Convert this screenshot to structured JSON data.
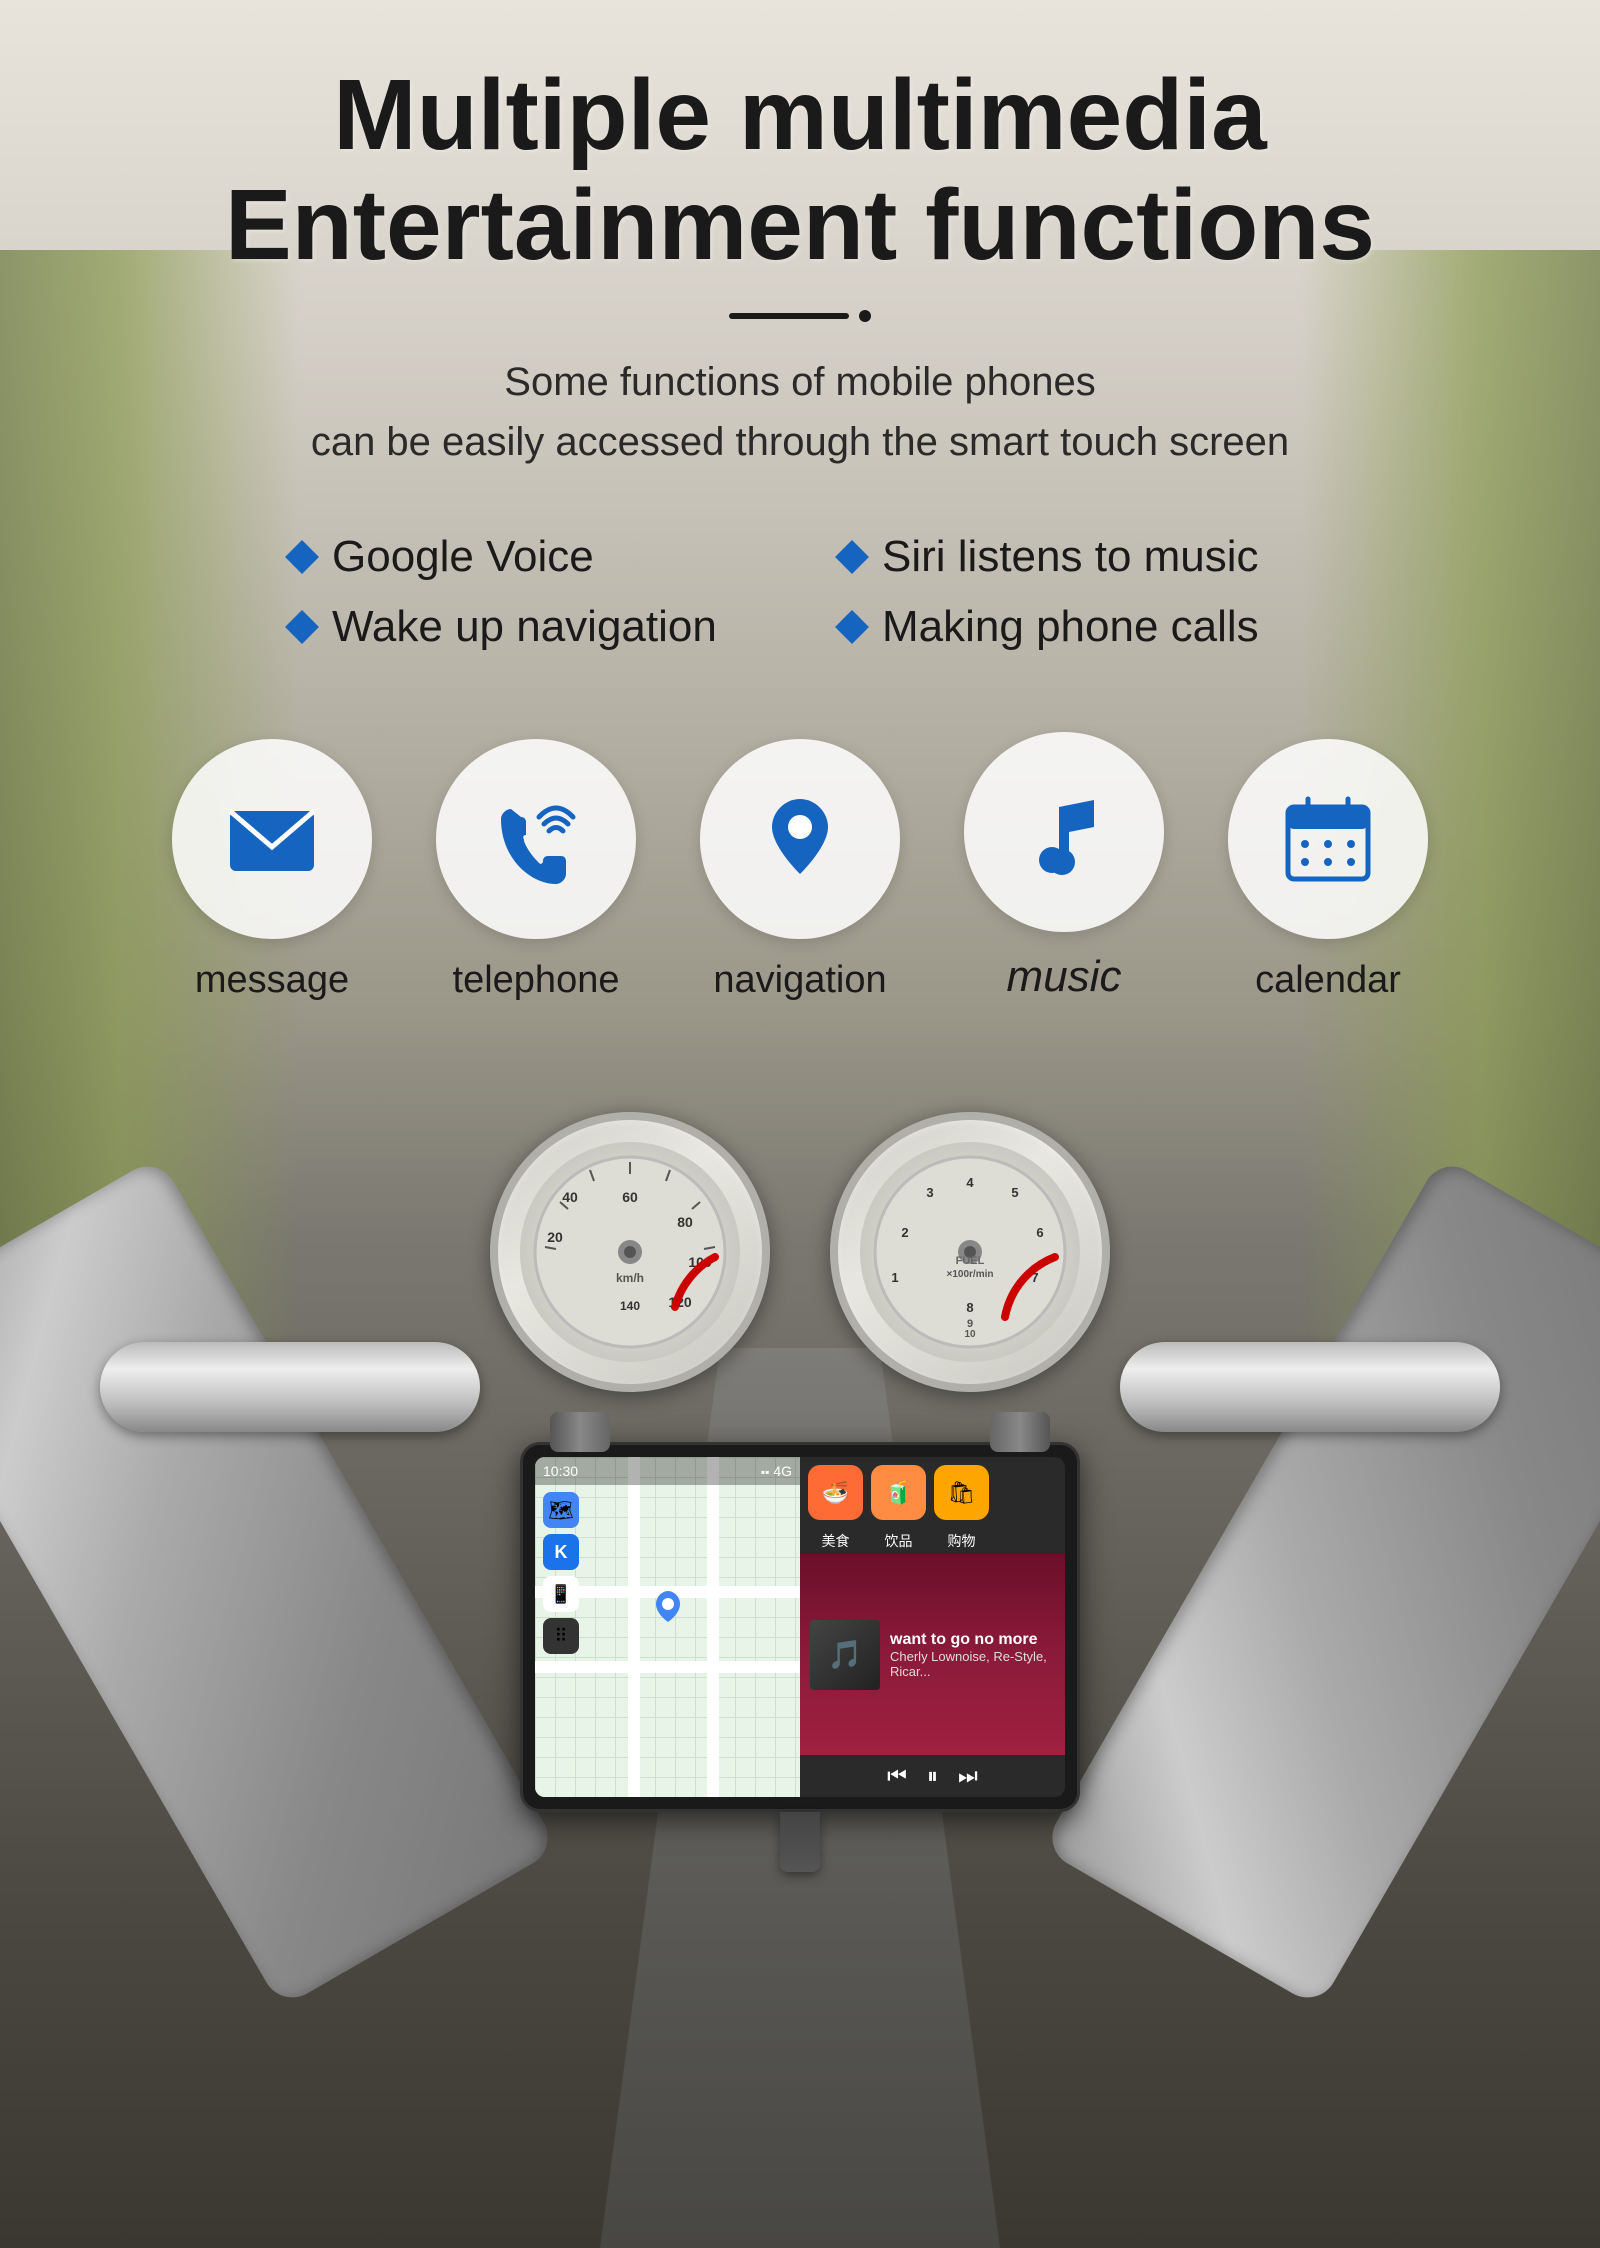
{
  "page": {
    "title_line1": "Multiple multimedia",
    "title_line2": "Entertainment functions",
    "divider_visible": true,
    "subtitle_line1": "Some functions of mobile phones",
    "subtitle_line2": "can be easily accessed through the smart touch screen"
  },
  "features": [
    {
      "id": "google-voice",
      "label": "Google Voice"
    },
    {
      "id": "siri-music",
      "label": "Siri listens to music"
    },
    {
      "id": "wake-navigation",
      "label": "Wake up navigation"
    },
    {
      "id": "phone-calls",
      "label": "Making phone calls"
    }
  ],
  "icons": [
    {
      "id": "message",
      "label": "message",
      "icon": "message-icon"
    },
    {
      "id": "telephone",
      "label": "telephone",
      "icon": "telephone-icon"
    },
    {
      "id": "navigation",
      "label": "navigation",
      "icon": "navigation-icon"
    },
    {
      "id": "music",
      "label": "music",
      "icon": "music-icon"
    },
    {
      "id": "calendar",
      "label": "calendar",
      "icon": "calendar-icon"
    }
  ],
  "device": {
    "status_time": "10:30",
    "status_signal": "4G",
    "song_title": "want to go no more",
    "song_artist": "Cherly Lownoise, Re-Style, Ricar...",
    "apps": [
      {
        "label": "美食",
        "color": "#FF6B35"
      },
      {
        "label": "饮品",
        "color": "#FF8C42"
      },
      {
        "label": "购物",
        "color": "#FFA500"
      }
    ]
  },
  "colors": {
    "accent_blue": "#1565C0",
    "title_dark": "#1a1a1a",
    "bg_light": "#e8e4dc",
    "icon_blue": "#1565C0"
  }
}
